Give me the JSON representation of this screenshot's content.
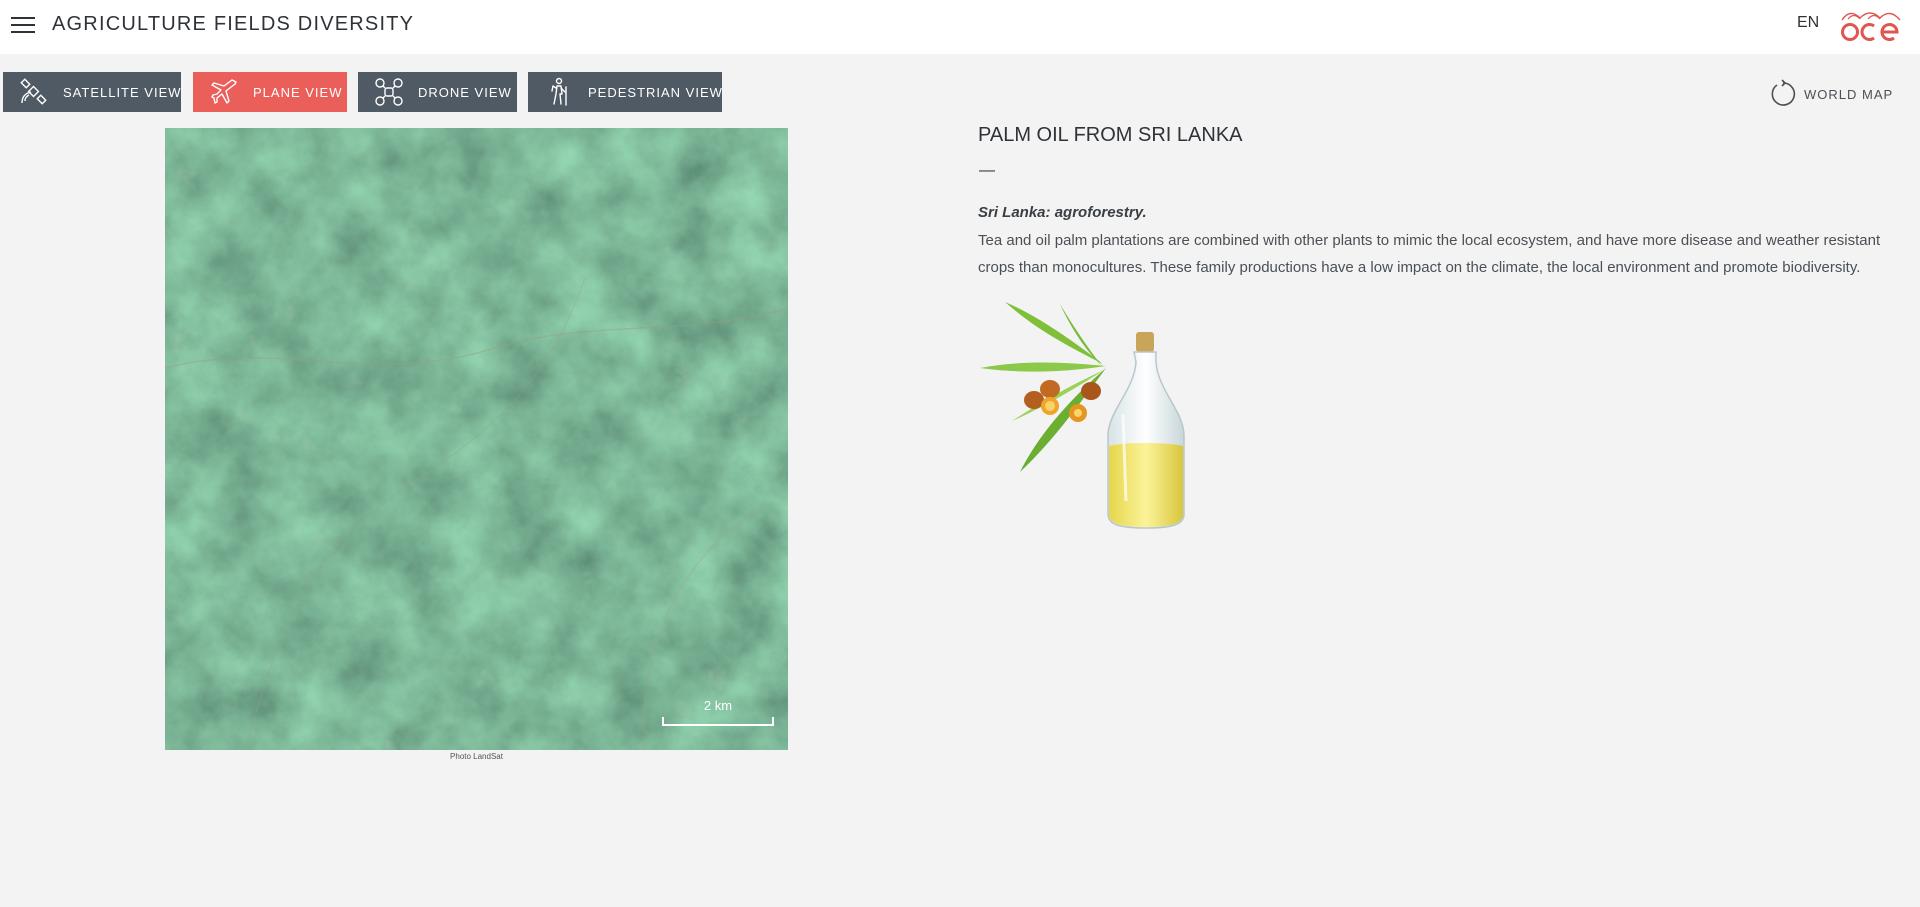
{
  "header": {
    "title": "AGRICULTURE FIELDS DIVERSITY",
    "language": "EN",
    "menu_icon": "hamburger-icon",
    "logo_icon": "oce-logo"
  },
  "tabs": [
    {
      "label": "SATELLITE VIEW",
      "icon": "satellite-icon",
      "active": false
    },
    {
      "label": "PLANE VIEW",
      "icon": "plane-icon",
      "active": true
    },
    {
      "label": "DRONE VIEW",
      "icon": "drone-icon",
      "active": false
    },
    {
      "label": "PEDESTRIAN VIEW",
      "icon": "hiker-icon",
      "active": false
    }
  ],
  "world_map": {
    "label": "WORLD MAP",
    "icon": "refresh-icon"
  },
  "image": {
    "scale_label": "2 km",
    "caption": "Photo LandSat"
  },
  "article": {
    "title": "PALM OIL FROM SRI LANKA",
    "dash": "—",
    "subtitle": "Sri Lanka: agroforestry.",
    "body": "Tea and oil palm plantations are combined with other plants to mimic the local ecosystem, and have more disease and weather resistant crops than monocultures. These family productions have a low impact on the climate, the local environment and promote biodiversity."
  },
  "colors": {
    "tab_default": "#505a64",
    "tab_active": "#ea5f5a",
    "brand": "#e0564f",
    "background": "#f3f3f3"
  }
}
